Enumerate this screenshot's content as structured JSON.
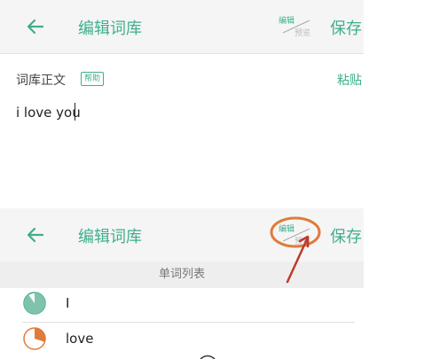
{
  "top_screen": {
    "header": {
      "title": "编辑词库",
      "save_label": "保存",
      "toggle": {
        "edit": "编辑",
        "preview": "预览"
      }
    },
    "content": {
      "section_label": "词库正文",
      "help_label": "帮助",
      "paste_label": "粘贴",
      "editor_text": "i love you"
    }
  },
  "bottom_screen": {
    "header": {
      "title": "编辑词库",
      "save_label": "保存",
      "toggle": {
        "edit": "编辑",
        "preview": "预览"
      }
    },
    "list_title": "单词列表",
    "items": [
      {
        "word": "I",
        "progress": 0.9
      },
      {
        "word": "love",
        "progress": 0.3
      }
    ]
  },
  "colors": {
    "accent": "#3fae8d",
    "annotation": "#e07b39",
    "arrow": "#c0392b"
  }
}
